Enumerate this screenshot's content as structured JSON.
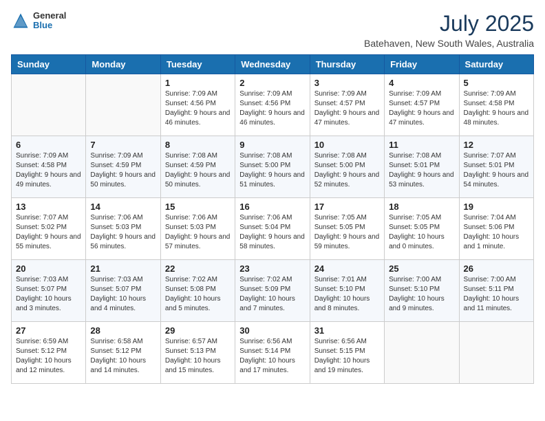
{
  "header": {
    "logo": {
      "general": "General",
      "blue": "Blue"
    },
    "title": "July 2025",
    "location": "Batehaven, New South Wales, Australia"
  },
  "weekdays": [
    "Sunday",
    "Monday",
    "Tuesday",
    "Wednesday",
    "Thursday",
    "Friday",
    "Saturday"
  ],
  "weeks": [
    [
      {
        "day": "",
        "sunrise": "",
        "sunset": "",
        "daylight": ""
      },
      {
        "day": "",
        "sunrise": "",
        "sunset": "",
        "daylight": ""
      },
      {
        "day": "1",
        "sunrise": "Sunrise: 7:09 AM",
        "sunset": "Sunset: 4:56 PM",
        "daylight": "Daylight: 9 hours and 46 minutes."
      },
      {
        "day": "2",
        "sunrise": "Sunrise: 7:09 AM",
        "sunset": "Sunset: 4:56 PM",
        "daylight": "Daylight: 9 hours and 46 minutes."
      },
      {
        "day": "3",
        "sunrise": "Sunrise: 7:09 AM",
        "sunset": "Sunset: 4:57 PM",
        "daylight": "Daylight: 9 hours and 47 minutes."
      },
      {
        "day": "4",
        "sunrise": "Sunrise: 7:09 AM",
        "sunset": "Sunset: 4:57 PM",
        "daylight": "Daylight: 9 hours and 47 minutes."
      },
      {
        "day": "5",
        "sunrise": "Sunrise: 7:09 AM",
        "sunset": "Sunset: 4:58 PM",
        "daylight": "Daylight: 9 hours and 48 minutes."
      }
    ],
    [
      {
        "day": "6",
        "sunrise": "Sunrise: 7:09 AM",
        "sunset": "Sunset: 4:58 PM",
        "daylight": "Daylight: 9 hours and 49 minutes."
      },
      {
        "day": "7",
        "sunrise": "Sunrise: 7:09 AM",
        "sunset": "Sunset: 4:59 PM",
        "daylight": "Daylight: 9 hours and 50 minutes."
      },
      {
        "day": "8",
        "sunrise": "Sunrise: 7:08 AM",
        "sunset": "Sunset: 4:59 PM",
        "daylight": "Daylight: 9 hours and 50 minutes."
      },
      {
        "day": "9",
        "sunrise": "Sunrise: 7:08 AM",
        "sunset": "Sunset: 5:00 PM",
        "daylight": "Daylight: 9 hours and 51 minutes."
      },
      {
        "day": "10",
        "sunrise": "Sunrise: 7:08 AM",
        "sunset": "Sunset: 5:00 PM",
        "daylight": "Daylight: 9 hours and 52 minutes."
      },
      {
        "day": "11",
        "sunrise": "Sunrise: 7:08 AM",
        "sunset": "Sunset: 5:01 PM",
        "daylight": "Daylight: 9 hours and 53 minutes."
      },
      {
        "day": "12",
        "sunrise": "Sunrise: 7:07 AM",
        "sunset": "Sunset: 5:01 PM",
        "daylight": "Daylight: 9 hours and 54 minutes."
      }
    ],
    [
      {
        "day": "13",
        "sunrise": "Sunrise: 7:07 AM",
        "sunset": "Sunset: 5:02 PM",
        "daylight": "Daylight: 9 hours and 55 minutes."
      },
      {
        "day": "14",
        "sunrise": "Sunrise: 7:06 AM",
        "sunset": "Sunset: 5:03 PM",
        "daylight": "Daylight: 9 hours and 56 minutes."
      },
      {
        "day": "15",
        "sunrise": "Sunrise: 7:06 AM",
        "sunset": "Sunset: 5:03 PM",
        "daylight": "Daylight: 9 hours and 57 minutes."
      },
      {
        "day": "16",
        "sunrise": "Sunrise: 7:06 AM",
        "sunset": "Sunset: 5:04 PM",
        "daylight": "Daylight: 9 hours and 58 minutes."
      },
      {
        "day": "17",
        "sunrise": "Sunrise: 7:05 AM",
        "sunset": "Sunset: 5:05 PM",
        "daylight": "Daylight: 9 hours and 59 minutes."
      },
      {
        "day": "18",
        "sunrise": "Sunrise: 7:05 AM",
        "sunset": "Sunset: 5:05 PM",
        "daylight": "Daylight: 10 hours and 0 minutes."
      },
      {
        "day": "19",
        "sunrise": "Sunrise: 7:04 AM",
        "sunset": "Sunset: 5:06 PM",
        "daylight": "Daylight: 10 hours and 1 minute."
      }
    ],
    [
      {
        "day": "20",
        "sunrise": "Sunrise: 7:03 AM",
        "sunset": "Sunset: 5:07 PM",
        "daylight": "Daylight: 10 hours and 3 minutes."
      },
      {
        "day": "21",
        "sunrise": "Sunrise: 7:03 AM",
        "sunset": "Sunset: 5:07 PM",
        "daylight": "Daylight: 10 hours and 4 minutes."
      },
      {
        "day": "22",
        "sunrise": "Sunrise: 7:02 AM",
        "sunset": "Sunset: 5:08 PM",
        "daylight": "Daylight: 10 hours and 5 minutes."
      },
      {
        "day": "23",
        "sunrise": "Sunrise: 7:02 AM",
        "sunset": "Sunset: 5:09 PM",
        "daylight": "Daylight: 10 hours and 7 minutes."
      },
      {
        "day": "24",
        "sunrise": "Sunrise: 7:01 AM",
        "sunset": "Sunset: 5:10 PM",
        "daylight": "Daylight: 10 hours and 8 minutes."
      },
      {
        "day": "25",
        "sunrise": "Sunrise: 7:00 AM",
        "sunset": "Sunset: 5:10 PM",
        "daylight": "Daylight: 10 hours and 9 minutes."
      },
      {
        "day": "26",
        "sunrise": "Sunrise: 7:00 AM",
        "sunset": "Sunset: 5:11 PM",
        "daylight": "Daylight: 10 hours and 11 minutes."
      }
    ],
    [
      {
        "day": "27",
        "sunrise": "Sunrise: 6:59 AM",
        "sunset": "Sunset: 5:12 PM",
        "daylight": "Daylight: 10 hours and 12 minutes."
      },
      {
        "day": "28",
        "sunrise": "Sunrise: 6:58 AM",
        "sunset": "Sunset: 5:12 PM",
        "daylight": "Daylight: 10 hours and 14 minutes."
      },
      {
        "day": "29",
        "sunrise": "Sunrise: 6:57 AM",
        "sunset": "Sunset: 5:13 PM",
        "daylight": "Daylight: 10 hours and 15 minutes."
      },
      {
        "day": "30",
        "sunrise": "Sunrise: 6:56 AM",
        "sunset": "Sunset: 5:14 PM",
        "daylight": "Daylight: 10 hours and 17 minutes."
      },
      {
        "day": "31",
        "sunrise": "Sunrise: 6:56 AM",
        "sunset": "Sunset: 5:15 PM",
        "daylight": "Daylight: 10 hours and 19 minutes."
      },
      {
        "day": "",
        "sunrise": "",
        "sunset": "",
        "daylight": ""
      },
      {
        "day": "",
        "sunrise": "",
        "sunset": "",
        "daylight": ""
      }
    ]
  ]
}
